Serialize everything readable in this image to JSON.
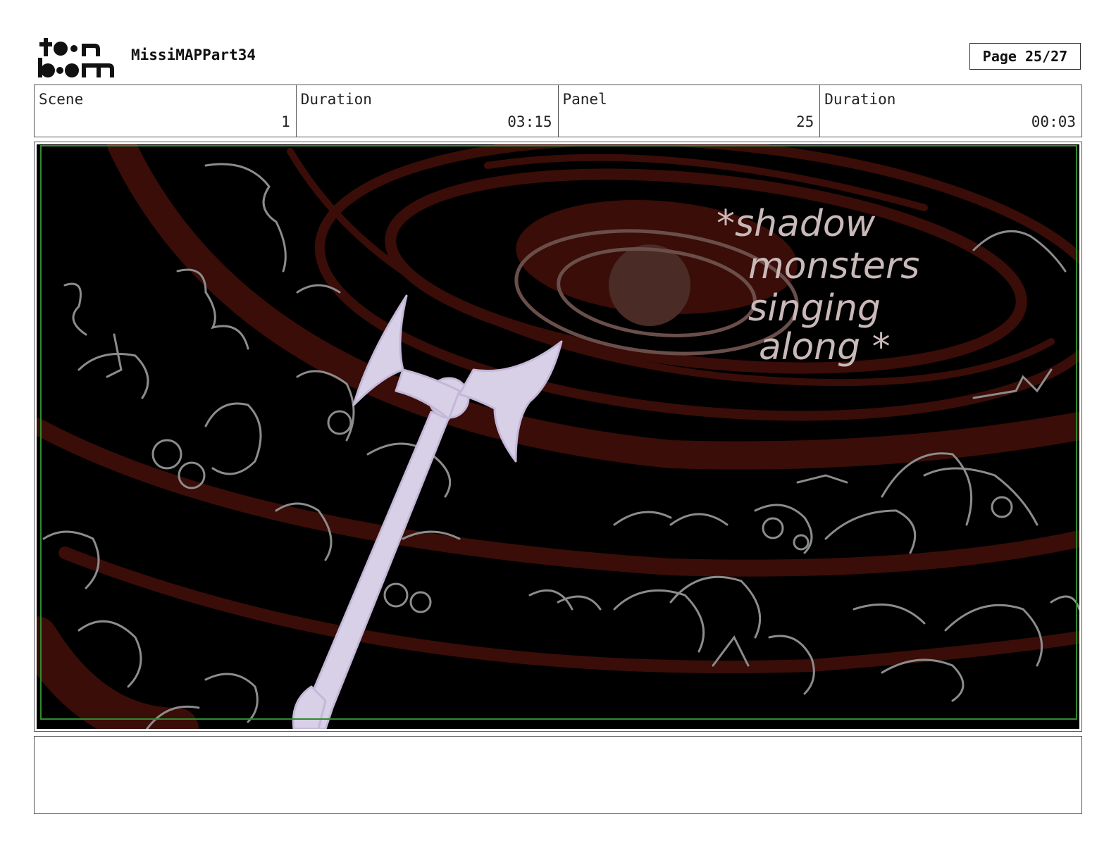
{
  "header": {
    "project_title": "MissiMAPPart34",
    "page_indicator": "Page 25/27"
  },
  "logo": {
    "top_word": "toon",
    "bottom_word": "boom"
  },
  "info": {
    "scene_label": "Scene",
    "scene_value": "1",
    "scene_duration_label": "Duration",
    "scene_duration_value": "03:15",
    "panel_label": "Panel",
    "panel_value": "25",
    "panel_duration_label": "Duration",
    "panel_duration_value": "00:03"
  },
  "panel": {
    "annotation_lines": [
      "*shadow",
      "monsters",
      "singing",
      "along *"
    ]
  },
  "colors": {
    "background": "#000000",
    "swirl": "#3a0d08",
    "sketch": "#9a9a9a",
    "scepter": "#d8d0e6",
    "safe_frame": "#2f8a2f"
  },
  "notes": ""
}
